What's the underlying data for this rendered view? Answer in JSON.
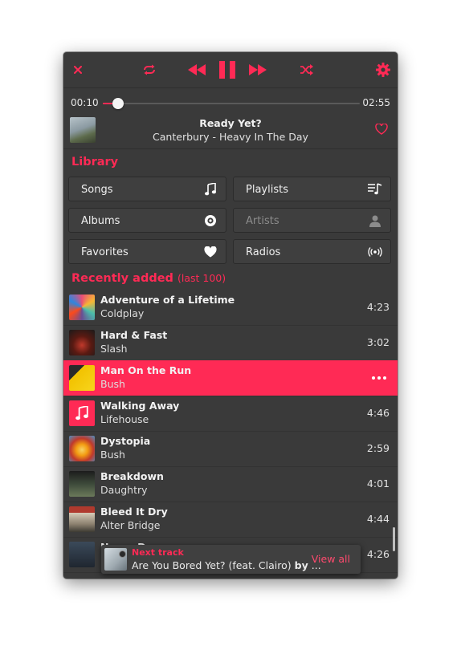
{
  "colors": {
    "accent": "#ff2a55",
    "background": "#3a3a3a",
    "text": "#eaeaea"
  },
  "toolbar": {
    "icons": [
      "close-icon",
      "repeat-icon",
      "previous-icon",
      "pause-icon",
      "next-icon",
      "shuffle-icon",
      "gear-icon"
    ]
  },
  "player": {
    "elapsed": "00:10",
    "total": "02:55",
    "progress_fraction": 0.06,
    "title": "Ready Yet?",
    "subtitle": "Canterbury - Heavy In The Day"
  },
  "library": {
    "title": "Library",
    "buttons": [
      {
        "label": "Songs",
        "icon": "music-note-icon",
        "enabled": true
      },
      {
        "label": "Playlists",
        "icon": "playlist-icon",
        "enabled": true
      },
      {
        "label": "Albums",
        "icon": "album-disc-icon",
        "enabled": true
      },
      {
        "label": "Artists",
        "icon": "person-icon",
        "enabled": false
      },
      {
        "label": "Favorites",
        "icon": "heart-icon",
        "enabled": true
      },
      {
        "label": "Radios",
        "icon": "radio-broadcast-icon",
        "enabled": true
      }
    ]
  },
  "recent": {
    "title": "Recently added",
    "note": "(last 100)",
    "tracks": [
      {
        "title": "Adventure of a Lifetime",
        "artist": "Coldplay",
        "duration": "4:23",
        "active": false
      },
      {
        "title": "Hard & Fast",
        "artist": "Slash",
        "duration": "3:02",
        "active": false
      },
      {
        "title": "Man On the Run",
        "artist": "Bush",
        "duration": "",
        "active": true
      },
      {
        "title": "Walking Away",
        "artist": "Lifehouse",
        "duration": "4:46",
        "active": false
      },
      {
        "title": "Dystopia",
        "artist": "Bush",
        "duration": "2:59",
        "active": false
      },
      {
        "title": "Breakdown",
        "artist": "Daughtry",
        "duration": "4:01",
        "active": false
      },
      {
        "title": "Bleed It Dry",
        "artist": "Alter Bridge",
        "duration": "4:44",
        "active": false
      },
      {
        "title": "Nerve Damage",
        "artist": "",
        "duration": "4:26",
        "active": false
      }
    ]
  },
  "next_track": {
    "label": "Next track",
    "text": "Are You Bored Yet? (feat. Clairo)",
    "by": "by",
    "ellipsis": "...",
    "view_all": "View all"
  }
}
